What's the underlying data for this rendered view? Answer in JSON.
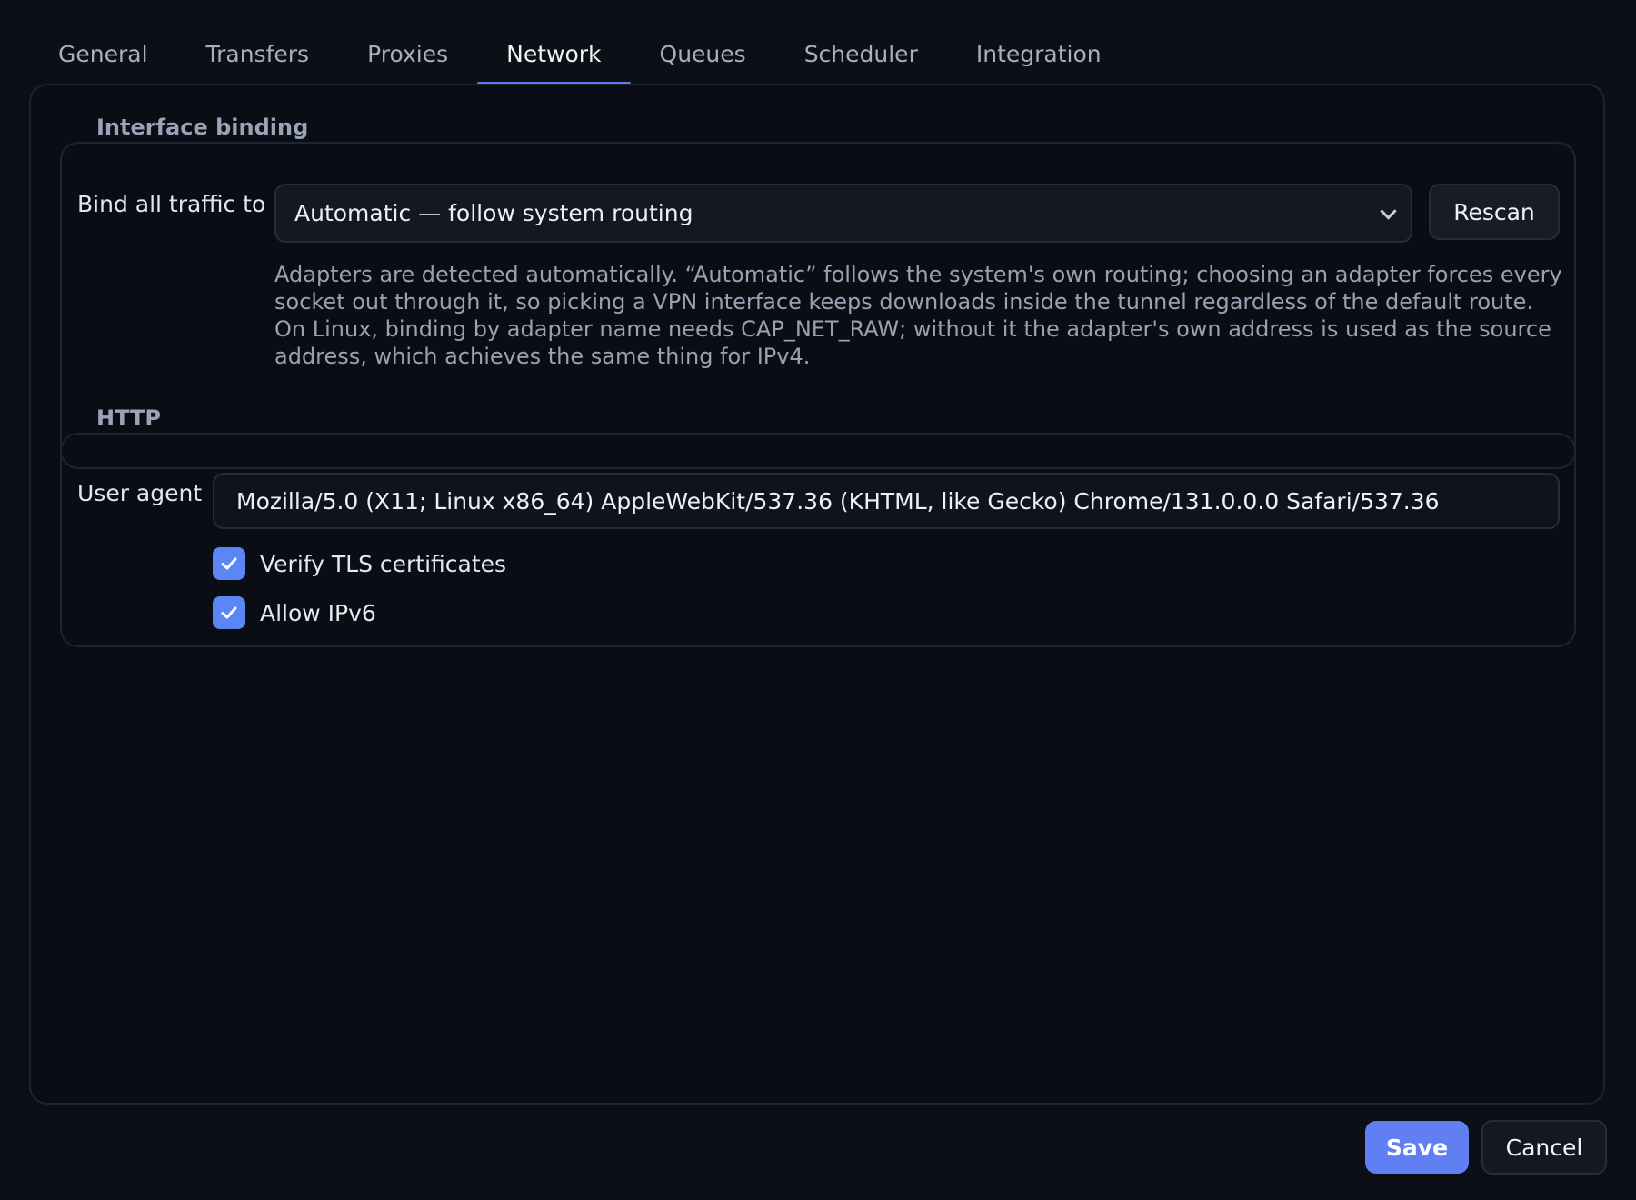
{
  "tabs": [
    {
      "label": "General"
    },
    {
      "label": "Transfers"
    },
    {
      "label": "Proxies"
    },
    {
      "label": "Network"
    },
    {
      "label": "Queues"
    },
    {
      "label": "Scheduler"
    },
    {
      "label": "Integration"
    }
  ],
  "active_tab": "Network",
  "interface_binding": {
    "legend": "Interface binding",
    "bind_label": "Bind all traffic to",
    "selected_adapter": "Automatic — follow system routing",
    "rescan_label": "Rescan",
    "help_text": "Adapters are detected automatically. “Automatic” follows the system's own routing; choosing an adapter forces every socket out through it, so picking a VPN interface keeps downloads inside the tunnel regardless of the default route. On Linux, binding by adapter name needs CAP_NET_RAW; without it the adapter's own address is used as the source address, which achieves the same thing for IPv4."
  },
  "http": {
    "legend": "HTTP",
    "user_agent_label": "User agent",
    "user_agent_value": "Mozilla/5.0 (X11; Linux x86_64) AppleWebKit/537.36 (KHTML, like Gecko) Chrome/131.0.0.0 Safari/537.36",
    "verify_tls": {
      "label": "Verify TLS certificates",
      "checked": true
    },
    "allow_ipv6": {
      "label": "Allow IPv6",
      "checked": true
    }
  },
  "footer": {
    "save_label": "Save",
    "cancel_label": "Cancel"
  },
  "colors": {
    "accent": "#5b7bf0",
    "checkbox": "#5b86f5",
    "background": "#0c0f16"
  },
  "icons": {
    "dropdown": "chevron-down-icon",
    "checkbox": "checkmark-icon"
  }
}
